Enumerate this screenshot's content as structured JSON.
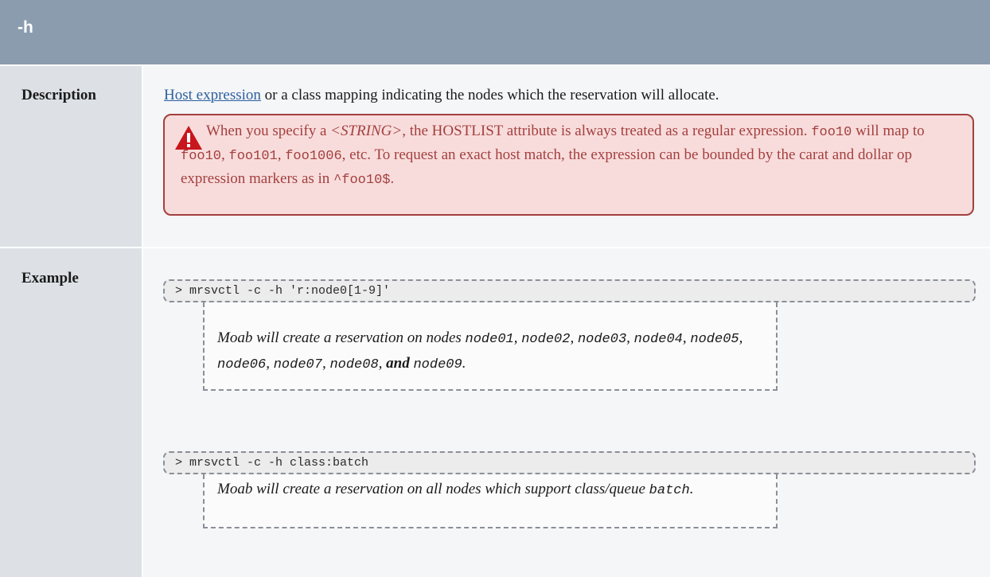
{
  "header": {
    "title": "-h"
  },
  "description": {
    "label": "Description",
    "link_text": "Host expression",
    "rest": " or a class mapping indicating the nodes which the reservation will allocate.",
    "warning": {
      "t1": "When you specify a ",
      "string_tag": "<STRING>",
      "t2": ", the HOSTLIST attribute is always treated as a regular expression. ",
      "c1": "foo10",
      "t3": " will map to ",
      "c2": "foo10",
      "t4": ", ",
      "c3": "foo101",
      "t5": ", ",
      "c4": "foo1006",
      "t6": ", etc. To request an exact host match, the expression can be bounded by the carat and dollar op expression markers as in ",
      "c5": "^foo10$",
      "t7": "."
    }
  },
  "example": {
    "label": "Example",
    "cmd1": "> mrsvctl -c -h 'r:node0[1-9]'",
    "result1": {
      "t1": "Moab will create a reservation on nodes ",
      "n1": "node01",
      "s1": ", ",
      "n2": "node02",
      "s2": ", ",
      "n3": "node03",
      "s3": ", ",
      "n4": "node04",
      "s4": ", ",
      "n5": "node05",
      "s5": ", ",
      "n6": "node06",
      "s6": ", ",
      "n7": "node07",
      "s7": ", ",
      "n8": "node08",
      "s8": ", ",
      "and": "and",
      "sp": " ",
      "n9": "node09",
      "end": "."
    },
    "cmd2": "> mrsvctl -c -h class:batch",
    "result2": {
      "t1": "Moab will create a reservation on all nodes which support class/queue ",
      "c1": "batch",
      "end": "."
    }
  },
  "colors": {
    "header_bg": "#8b9cae",
    "label_bg": "#dde1e6",
    "warning_bg": "#f8dcdc",
    "warning_border": "#a3403e",
    "link": "#2b5f9e"
  }
}
